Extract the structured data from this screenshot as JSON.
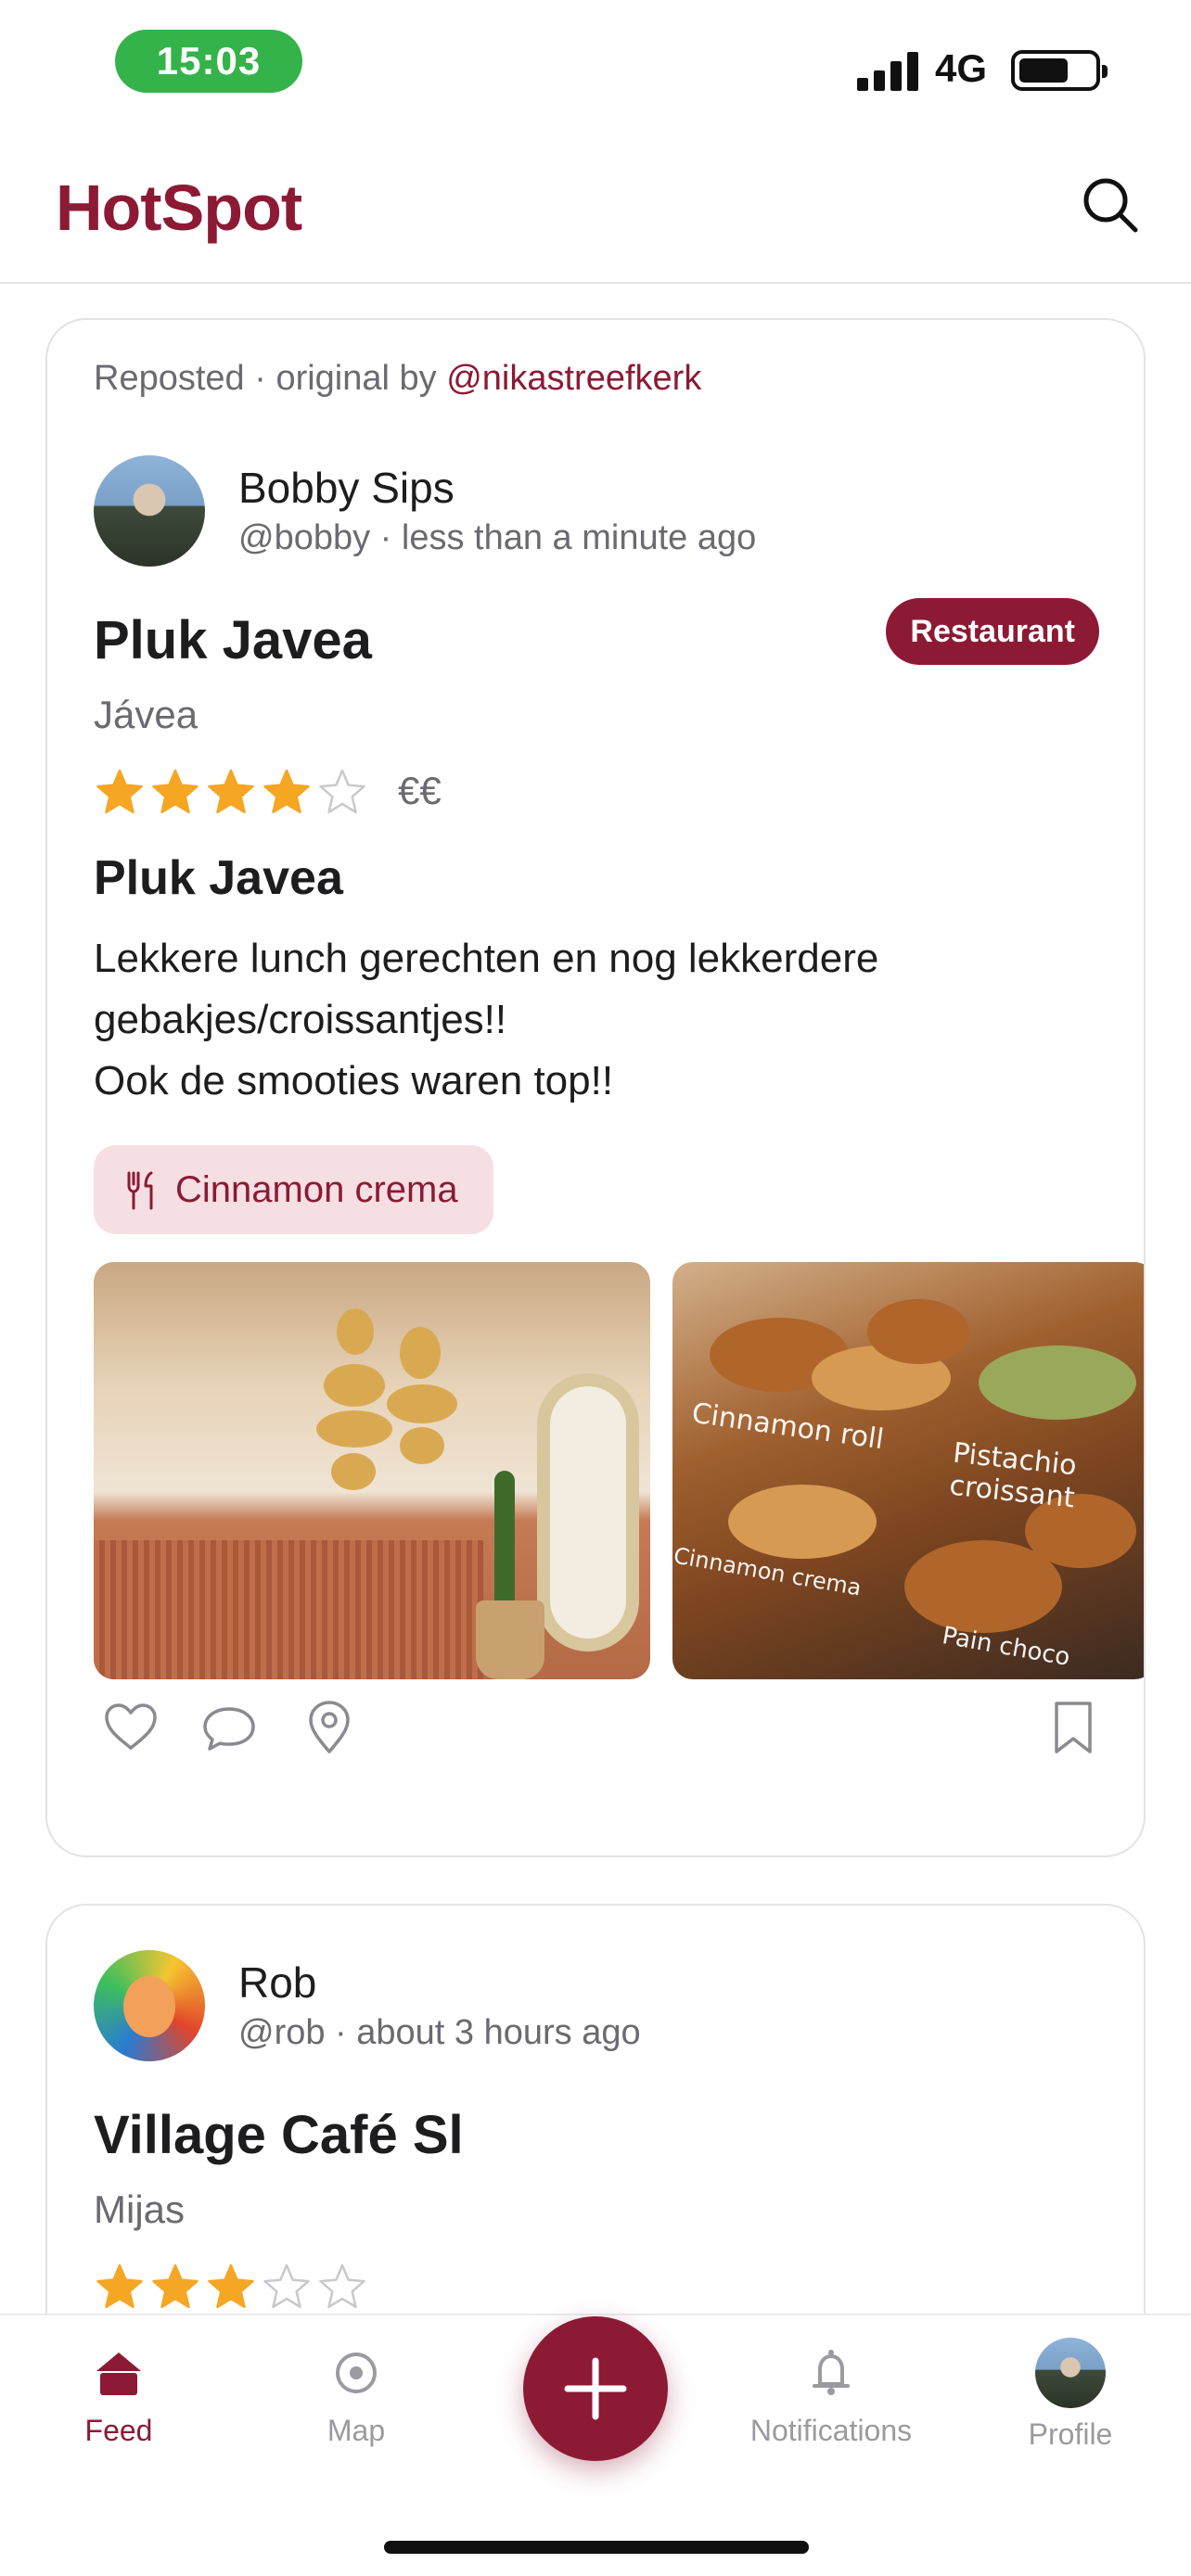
{
  "status_bar": {
    "time": "15:03",
    "network": "4G",
    "icons": [
      "signal-bars-icon",
      "battery-icon"
    ]
  },
  "header": {
    "app_title": "HotSpot",
    "search_icon": "search-icon"
  },
  "posts": [
    {
      "repost": {
        "prefix": "Reposted · original by ",
        "handle": "@nikastreefkerk"
      },
      "author": {
        "name": "Bobby Sips",
        "meta": "@bobby · less than a minute ago"
      },
      "category": "Restaurant",
      "place": "Pluk Javea",
      "city": "Jávea",
      "rating": 4,
      "rating_max": 5,
      "price": "€€",
      "title": "Pluk Javea",
      "body": [
        "Lekkere lunch gerechten en nog lekkerdere",
        "gebakjes/croissantjes!!",
        "Ook de smooties waren top!!"
      ],
      "dish": "Cinnamon crema",
      "photo_labels": [
        "Cinnamon roll",
        "Pistachio croissant",
        "Cinnamon crema",
        "Pain choco"
      ],
      "actions": [
        "heart-icon",
        "comment-icon",
        "location-pin-icon",
        "bookmark-icon"
      ]
    },
    {
      "author": {
        "name": "Rob",
        "meta": "@rob · about 3 hours ago"
      },
      "place": "Village Café Sl",
      "city": "Mijas",
      "rating": 3,
      "rating_max": 5
    }
  ],
  "tab_bar": {
    "tabs": [
      {
        "label": "Feed",
        "icon": "home-icon",
        "active": true
      },
      {
        "label": "Map",
        "icon": "map-target-icon",
        "active": false
      },
      {
        "label": "Notifications",
        "icon": "bell-icon",
        "active": false
      },
      {
        "label": "Profile",
        "icon": "profile-avatar",
        "active": false
      }
    ],
    "fab_icon": "plus-icon"
  },
  "colors": {
    "brand": "#8c1a34",
    "star": "#f5a623",
    "chip_bg": "#f6dfe3",
    "time_pill": "#34b34a"
  }
}
